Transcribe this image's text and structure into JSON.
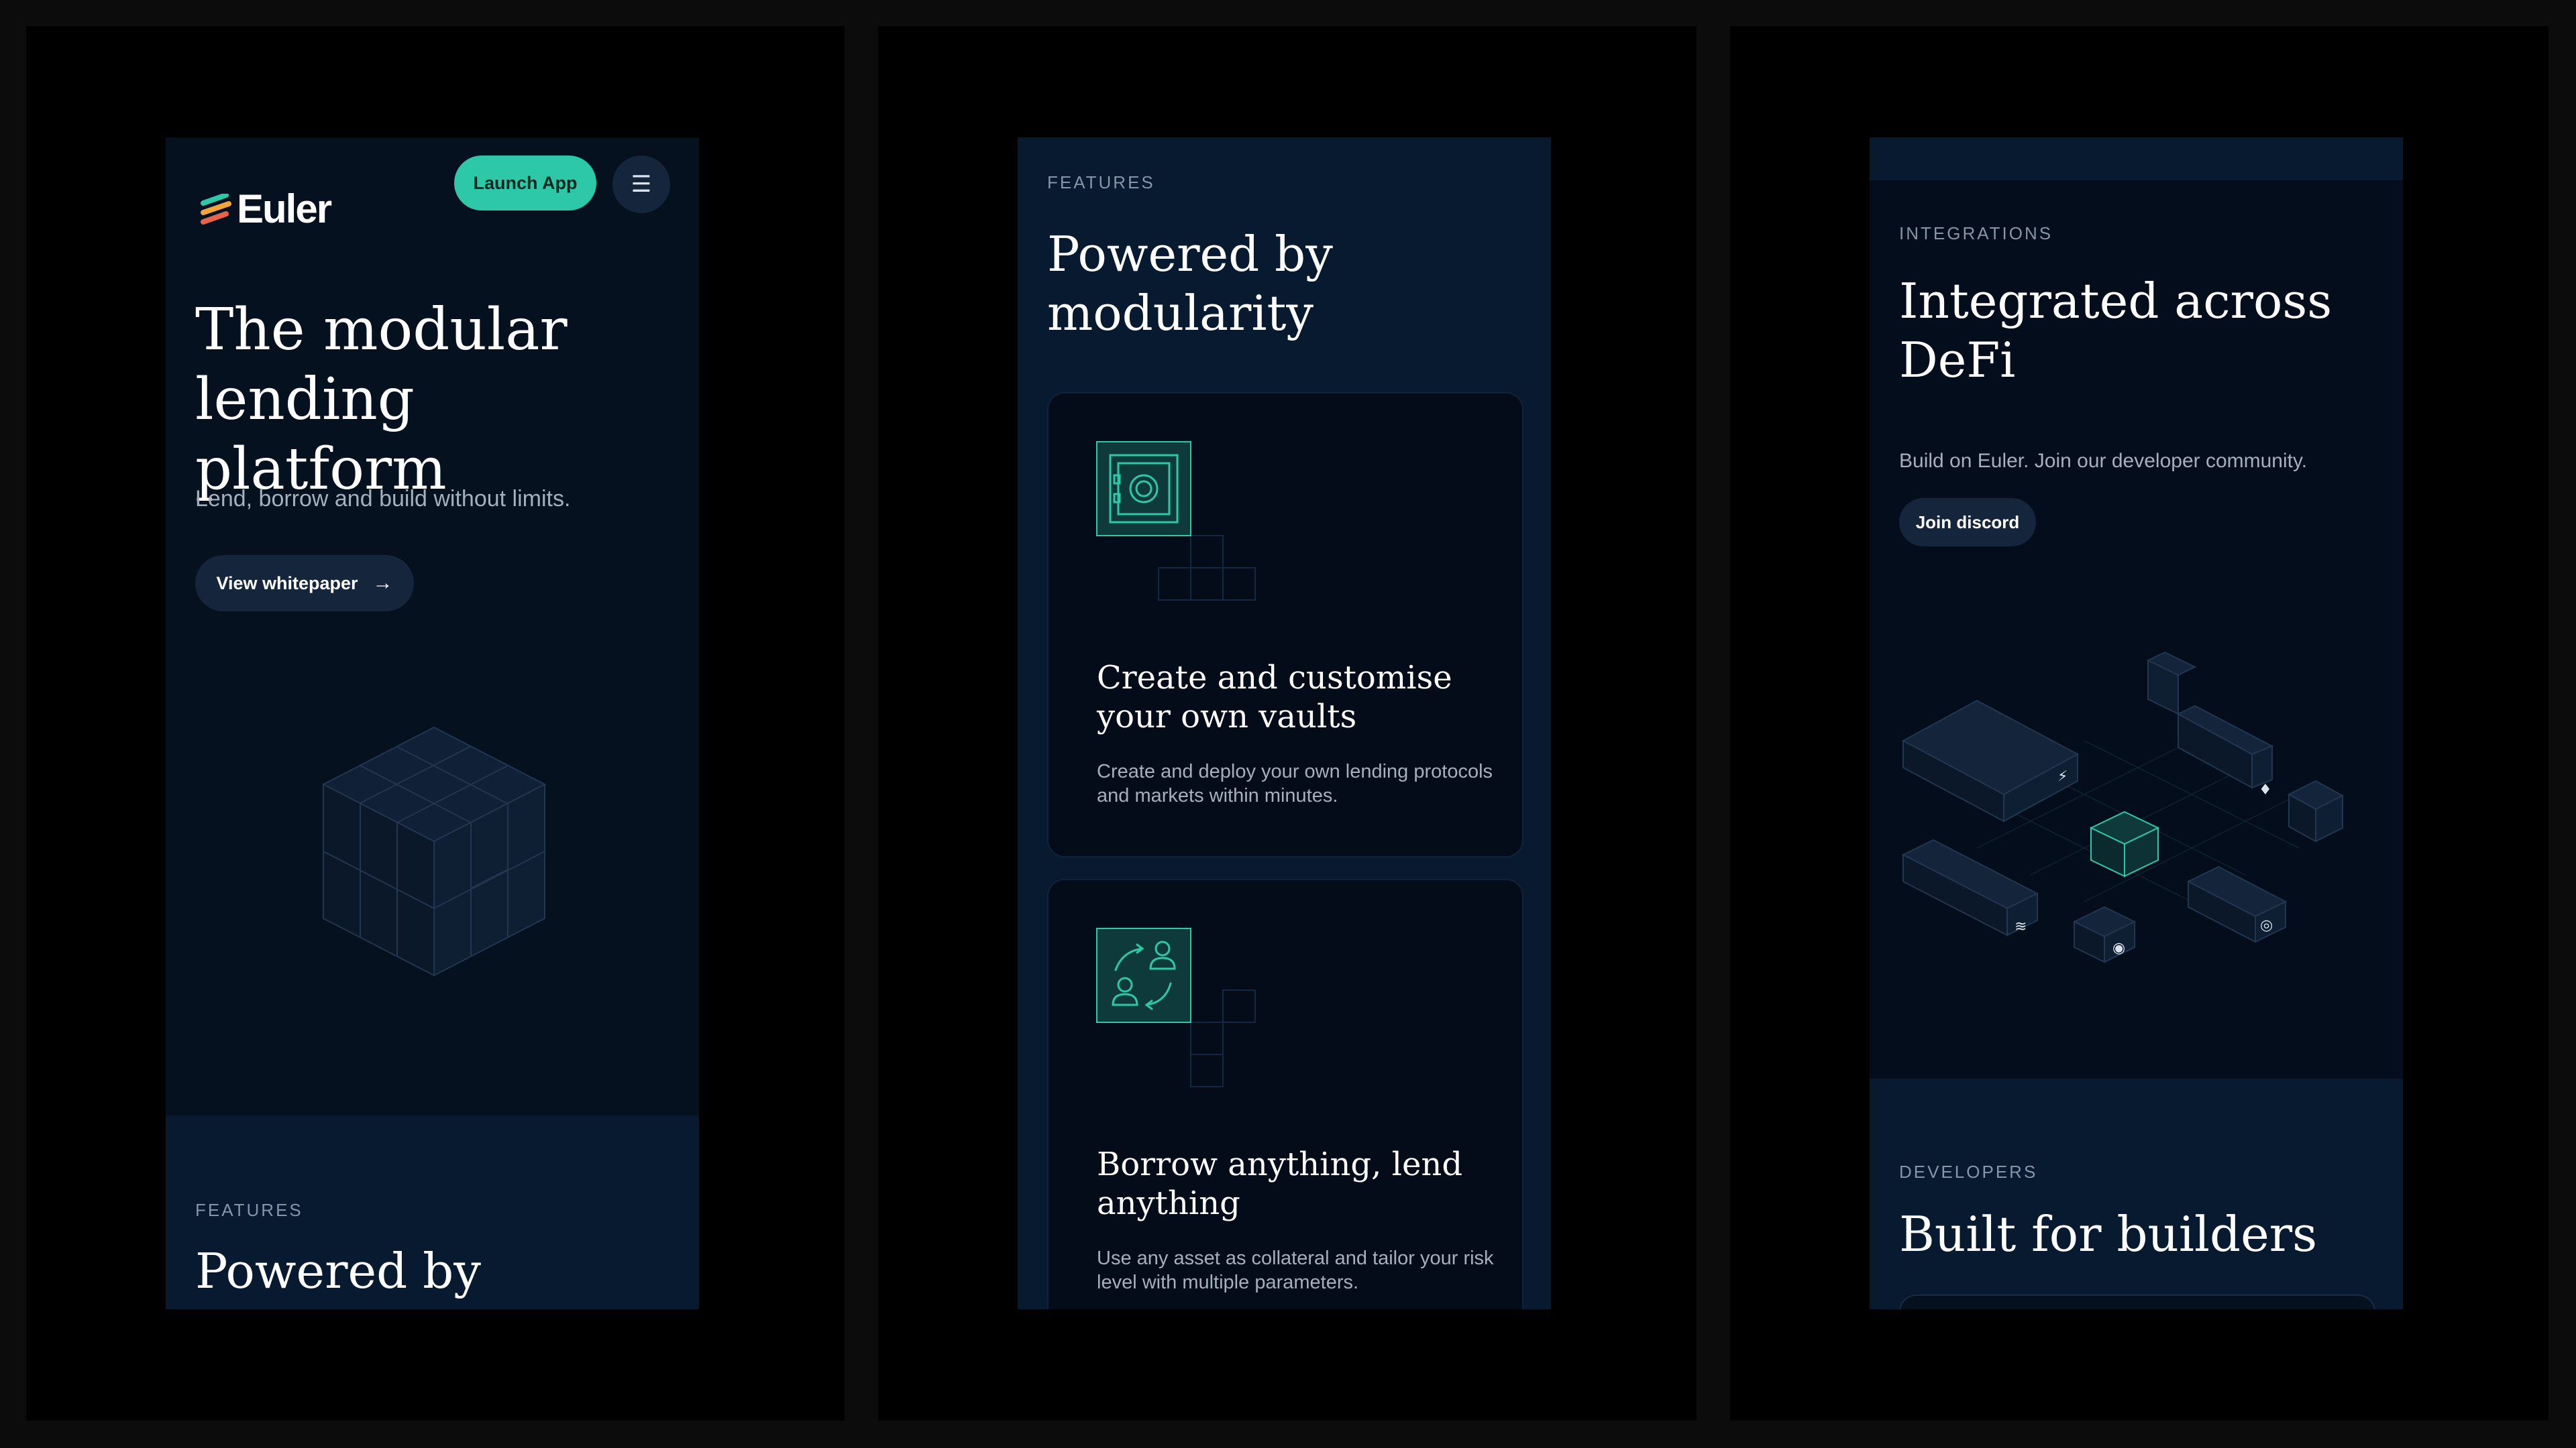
{
  "screen1": {
    "logo_text": "Euler",
    "launch_label": "Launch App",
    "menu_icon": "hamburger-icon",
    "hero_title": "The modular lending platform",
    "hero_subtitle": "Lend, borrow and build without limits.",
    "whitepaper_label": "View whitepaper",
    "features_eyebrow": "FEATURES",
    "features_title": "Powered by"
  },
  "screen2": {
    "eyebrow": "FEATURES",
    "title": "Powered by modularity",
    "cards": [
      {
        "icon": "vault-icon",
        "title": "Create and customise your own vaults",
        "desc": "Create and deploy your own lending protocols and markets within minutes."
      },
      {
        "icon": "exchange-users-icon",
        "title": "Borrow anything, lend anything",
        "desc": "Use any asset as collateral and tailor your risk level with multiple parameters."
      }
    ]
  },
  "screen3": {
    "eyebrow": "INTEGRATIONS",
    "title": "Integrated across DeFi",
    "subtitle": "Build on Euler. Join our developer community.",
    "discord_label": "Join discord",
    "dev_eyebrow": "DEVELOPERS",
    "dev_title": "Built for builders"
  },
  "colors": {
    "accent": "#2cc8a8",
    "page_bg": "#05111f",
    "band_bg": "#081a30",
    "button_bg": "#15253c"
  }
}
